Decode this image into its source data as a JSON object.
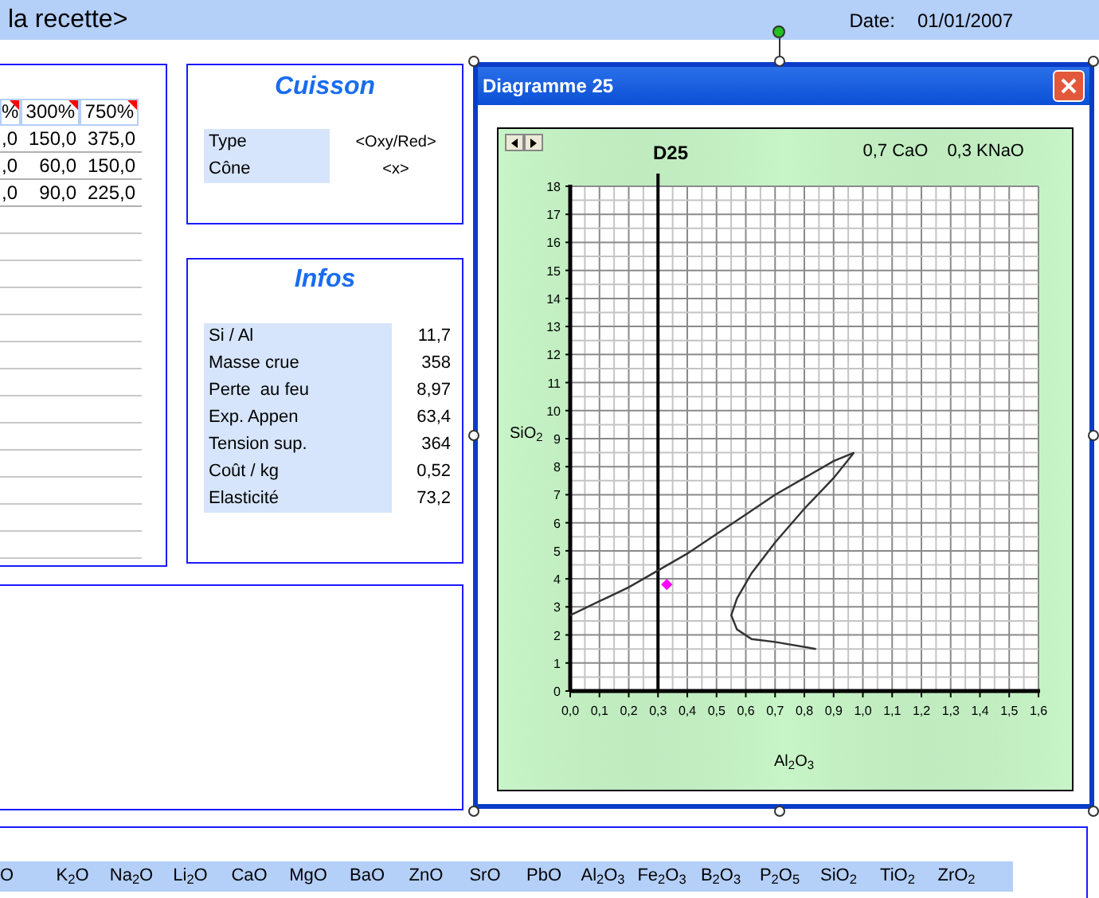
{
  "header": {
    "title": "la recette>",
    "date_label": "Date:",
    "date": "01/01/2007"
  },
  "recipe_table": {
    "columns": [
      {
        "label": "%",
        "has_comment": true
      },
      {
        "label": "300%",
        "has_comment": true
      },
      {
        "label": "750%",
        "has_comment": true
      }
    ],
    "rows": [
      [
        ",0",
        "150,0",
        "375,0"
      ],
      [
        ",0",
        "60,0",
        "150,0"
      ],
      [
        ",0",
        "90,0",
        "225,0"
      ]
    ]
  },
  "cuisson": {
    "title": "Cuisson",
    "rows": [
      {
        "label": "Type",
        "value": "<Oxy/Red>"
      },
      {
        "label": "Cône",
        "value": "<x>"
      }
    ]
  },
  "infos": {
    "title": "Infos",
    "rows": [
      {
        "label": "Si / Al",
        "value": "11,7"
      },
      {
        "label": "Masse crue",
        "value": "358"
      },
      {
        "label": "Perte  au feu",
        "value": "8,97"
      },
      {
        "label": "Exp. Appen",
        "value": "63,4"
      },
      {
        "label": "Tension sup.",
        "value": "364"
      },
      {
        "label": "Coût / kg",
        "value": "0,52"
      },
      {
        "label": "Elasticité",
        "value": "73,2"
      }
    ]
  },
  "chart_window": {
    "title": "Diagramme 25",
    "chart_data": {
      "type": "line",
      "title": "D25",
      "xlabel": "Al$_{2}$O$_{3}$",
      "ylabel": "SiO$_{2}$",
      "xlim": [
        0,
        1.6
      ],
      "ylim": [
        0,
        18
      ],
      "xticks": [
        {
          "value": 0,
          "label": "0,0"
        },
        {
          "value": 0.1,
          "label": "0,1"
        },
        {
          "value": 0.2,
          "label": "0,2"
        },
        {
          "value": 0.3,
          "label": "0,3"
        },
        {
          "value": 0.4,
          "label": "0,4"
        },
        {
          "value": 0.5,
          "label": "0,5"
        },
        {
          "value": 0.6,
          "label": "0,6"
        },
        {
          "value": 0.7,
          "label": "0,7"
        },
        {
          "value": 0.8,
          "label": "0,8"
        },
        {
          "value": 0.9,
          "label": "0,9"
        },
        {
          "value": 1,
          "label": "1,0"
        },
        {
          "value": 1.1,
          "label": "1,1"
        },
        {
          "value": 1.2,
          "label": "1,2"
        },
        {
          "value": 1.3,
          "label": "1,3"
        },
        {
          "value": 1.4,
          "label": "1,4"
        },
        {
          "value": 1.5,
          "label": "1,5"
        },
        {
          "value": 1.6,
          "label": "1,6"
        }
      ],
      "yticks": [
        0,
        1,
        2,
        3,
        4,
        5,
        6,
        7,
        8,
        9,
        10,
        11,
        12,
        13,
        14,
        15,
        16,
        17,
        18
      ],
      "series": [
        {
          "color": "#333333",
          "x": [
            0,
            0.1,
            0.2,
            0.3,
            0.4,
            0.5,
            0.6,
            0.7,
            0.8,
            0.9,
            0.97,
            0.9,
            0.8,
            0.7,
            0.62,
            0.57,
            0.55,
            0.57,
            0.62,
            0.7,
            0.84
          ],
          "values": [
            2.7,
            3.2,
            3.7,
            4.3,
            4.9,
            5.6,
            6.3,
            7.0,
            7.6,
            8.2,
            8.5,
            7.6,
            6.5,
            5.3,
            4.2,
            3.3,
            2.7,
            2.2,
            1.85,
            1.75,
            1.5
          ]
        },
        {
          "color": "#ff00ff",
          "marker": "diamond",
          "x": [
            0.33
          ],
          "values": [
            3.8
          ]
        }
      ],
      "grid": true,
      "ref_lines": [
        {
          "axis": "x",
          "value": 0.3,
          "color": "#000000"
        }
      ],
      "annotations": [
        {
          "text": "0,7 CaO"
        },
        {
          "text": "0,3 KNaO"
        }
      ]
    }
  },
  "oxides": [
    "O",
    "K$_{2}$O",
    "Na$_{2}$O",
    "Li$_{2}$O",
    "CaO",
    "MgO",
    "BaO",
    "ZnO",
    "SrO",
    "PbO",
    "Al$_{2}$O$_{3}$",
    "Fe$_{2}$O$_{3}$",
    "B$_{2}$O$_{3}$",
    "P$_{2}$O$_{5}$",
    "SiO$_{2}$",
    "TiO$_{2}$",
    "ZrO$_{2}$"
  ]
}
